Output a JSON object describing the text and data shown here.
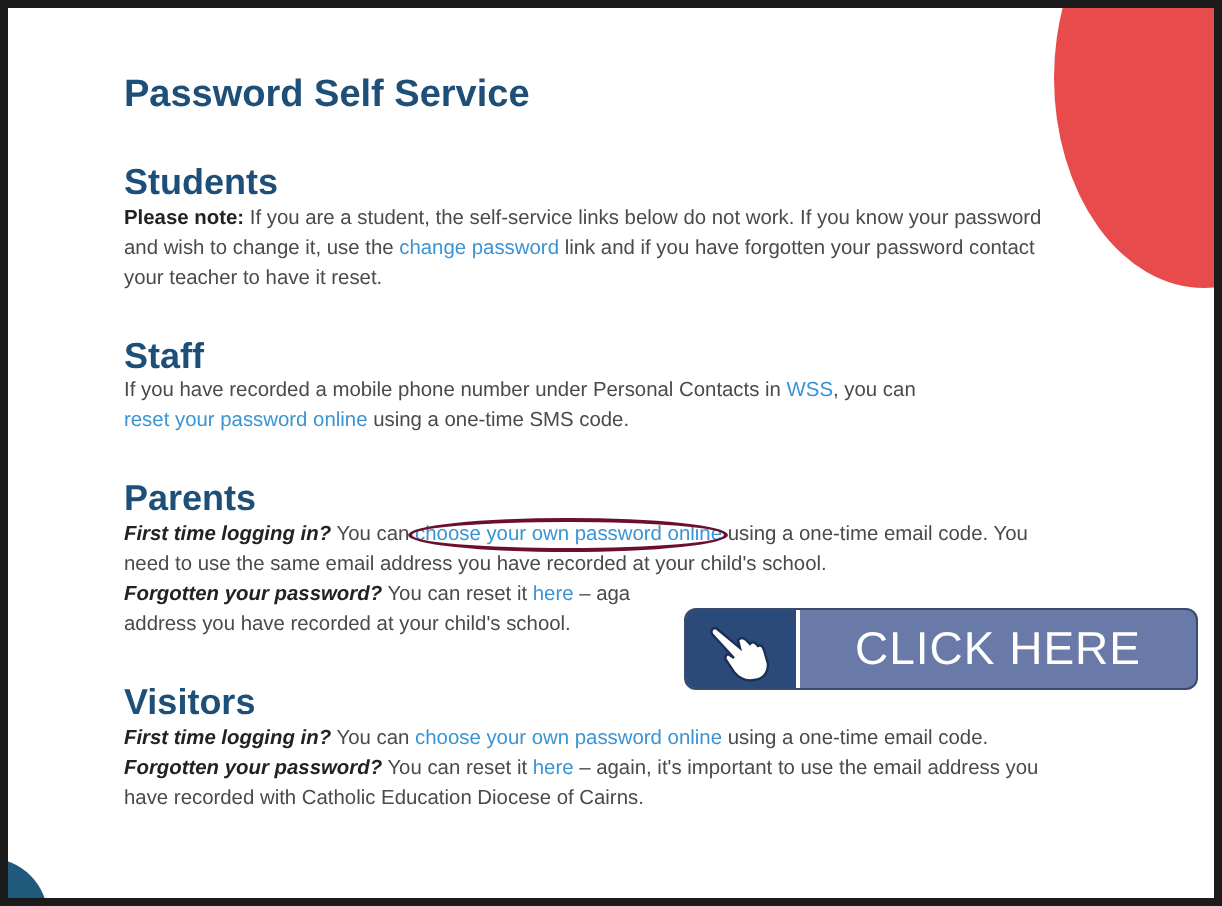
{
  "page": {
    "title": "Password Self Service",
    "sections": [
      {
        "heading": "Students",
        "paragraphs": [
          [
            {
              "kind": "bold",
              "text": "Please note:"
            },
            {
              "kind": "plain",
              "text": " If you are a student, the self-service links below do not work. If you know your password and wish to change it, use the "
            },
            {
              "kind": "link",
              "text": "change password",
              "circled": false
            },
            {
              "kind": "plain",
              "text": " link and if you have forgotten your password contact your teacher to have it reset."
            }
          ]
        ]
      },
      {
        "heading": "Staff",
        "paragraphs": [
          [
            {
              "kind": "plain",
              "text": "If you have recorded a mobile phone number under Personal Contacts in "
            },
            {
              "kind": "link",
              "text": "WSS",
              "circled": false
            },
            {
              "kind": "plain",
              "text": ", you can "
            },
            {
              "kind": "link",
              "text": "reset your password online",
              "circled": false
            },
            {
              "kind": "plain",
              "text": " using a one-time SMS code."
            }
          ]
        ]
      },
      {
        "heading": "Parents",
        "paragraphs": [
          [
            {
              "kind": "bolditalic",
              "text": "First time logging in?"
            },
            {
              "kind": "plain",
              "text": " You can "
            },
            {
              "kind": "link",
              "text": "choose your own password online",
              "circled": true
            },
            {
              "kind": "plain",
              "text": " using a one-time email code. You need to use the same email address you have recorded at your child's school."
            }
          ],
          [
            {
              "kind": "bolditalic",
              "text": "Forgotten your password?"
            },
            {
              "kind": "plain",
              "text": " You can reset it "
            },
            {
              "kind": "link",
              "text": "here",
              "circled": false
            },
            {
              "kind": "plain",
              "text": " – aga"
            },
            {
              "kind": "break"
            },
            {
              "kind": "plain",
              "text": "address you have recorded at your child's school."
            }
          ]
        ]
      },
      {
        "heading": "Visitors",
        "paragraphs": [
          [
            {
              "kind": "bolditalic",
              "text": "First time logging in?"
            },
            {
              "kind": "plain",
              "text": " You can "
            },
            {
              "kind": "link",
              "text": "choose your own password online",
              "circled": false
            },
            {
              "kind": "plain",
              "text": " using a one-time email code."
            }
          ],
          [
            {
              "kind": "bolditalic",
              "text": "Forgotten your password?"
            },
            {
              "kind": "plain",
              "text": " You can reset it "
            },
            {
              "kind": "link",
              "text": "here",
              "circled": false
            },
            {
              "kind": "plain",
              "text": " – again, it's important to use the email address you have recorded with Catholic Education Diocese of Cairns."
            }
          ]
        ]
      }
    ]
  },
  "overlay_button": {
    "label": "CLICK HERE"
  }
}
